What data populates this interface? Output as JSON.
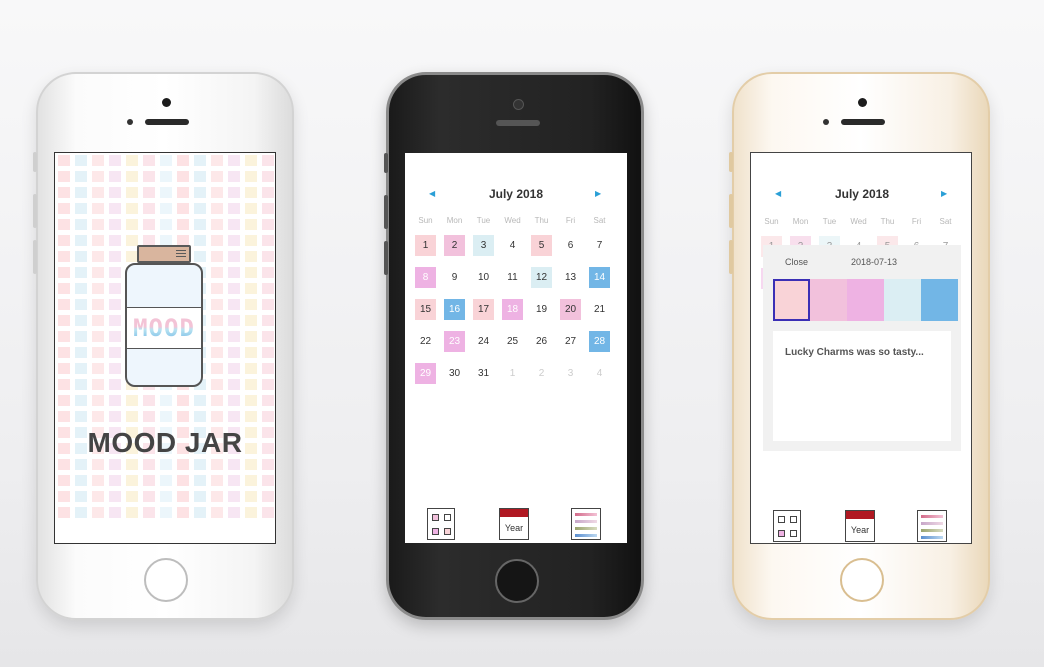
{
  "colors": {
    "mood_1": "#f9d3d7",
    "mood_2": "#f2c1dc",
    "mood_3": "#eeb2e3",
    "mood_4": "#dbeef3",
    "mood_5": "#72b6e6",
    "accent_red": "#b01822",
    "nav_arrow": "#2a9fd6"
  },
  "splash": {
    "app_title": "MOOD JAR",
    "jar_label": "MOOD"
  },
  "calendar": {
    "month_title": "July 2018",
    "weekdays": [
      "Sun",
      "Mon",
      "Tue",
      "Wed",
      "Thu",
      "Fri",
      "Sat"
    ],
    "days": [
      {
        "n": "1",
        "mood": 1
      },
      {
        "n": "2",
        "mood": 2
      },
      {
        "n": "3",
        "mood": 4
      },
      {
        "n": "4",
        "mood": 0
      },
      {
        "n": "5",
        "mood": 1
      },
      {
        "n": "6",
        "mood": 0
      },
      {
        "n": "7",
        "mood": 0
      },
      {
        "n": "8",
        "mood": 3
      },
      {
        "n": "9",
        "mood": 0
      },
      {
        "n": "10",
        "mood": 0
      },
      {
        "n": "11",
        "mood": 0
      },
      {
        "n": "12",
        "mood": 4
      },
      {
        "n": "13",
        "mood": 0
      },
      {
        "n": "14",
        "mood": 5
      },
      {
        "n": "15",
        "mood": 1
      },
      {
        "n": "16",
        "mood": 5
      },
      {
        "n": "17",
        "mood": 1
      },
      {
        "n": "18",
        "mood": 3
      },
      {
        "n": "19",
        "mood": 0
      },
      {
        "n": "20",
        "mood": 2
      },
      {
        "n": "21",
        "mood": 0
      },
      {
        "n": "22",
        "mood": 0
      },
      {
        "n": "23",
        "mood": 3
      },
      {
        "n": "24",
        "mood": 0
      },
      {
        "n": "25",
        "mood": 0
      },
      {
        "n": "26",
        "mood": 0
      },
      {
        "n": "27",
        "mood": 0
      },
      {
        "n": "28",
        "mood": 5
      },
      {
        "n": "29",
        "mood": 3
      },
      {
        "n": "30",
        "mood": 0
      },
      {
        "n": "31",
        "mood": 0
      },
      {
        "n": "1",
        "mood": -1
      },
      {
        "n": "2",
        "mood": -1
      },
      {
        "n": "3",
        "mood": -1
      },
      {
        "n": "4",
        "mood": -1
      }
    ]
  },
  "tabs": {
    "year_label": "Year"
  },
  "modal": {
    "close_label": "Close",
    "date": "2018-07-13",
    "selected_mood": 1,
    "note": "Lucky Charms was so tasty..."
  }
}
